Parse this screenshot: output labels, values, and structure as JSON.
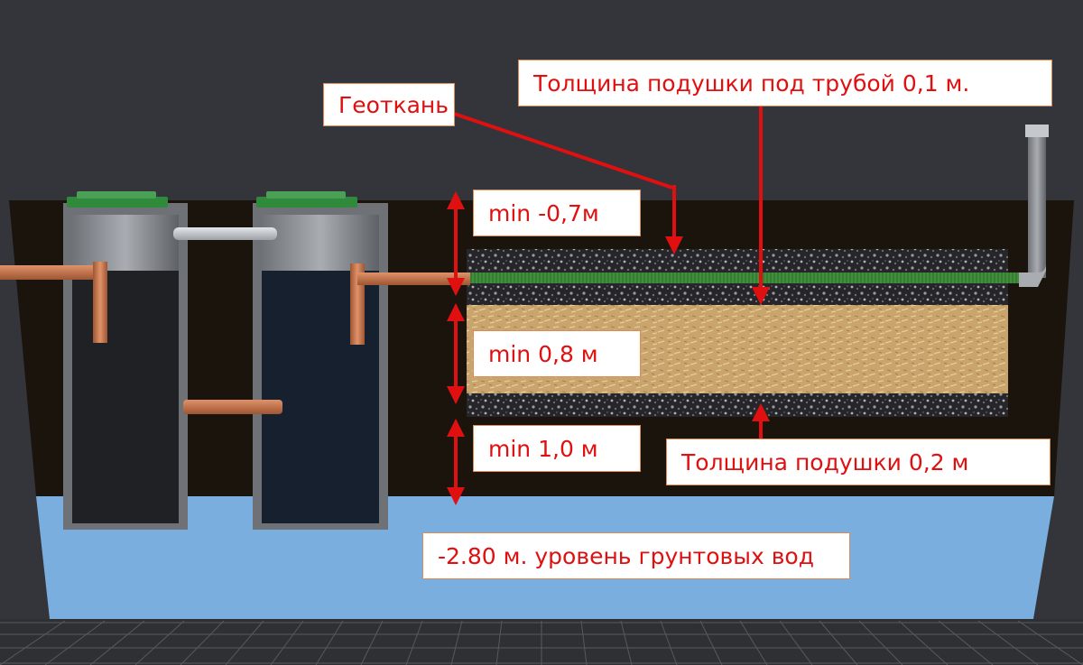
{
  "labels": {
    "geotextile": "Геоткань",
    "pipe_bed": "Толщина подушки под трубой 0,1 м.",
    "min_cover": "min -0,7м",
    "min_sand": "min 0,8 м",
    "min_clearance": "min 1,0 м",
    "bed": "Толщина подушки 0,2 м",
    "groundwater": "-2.80 м. уровень грунтовых вод"
  },
  "colors": {
    "background": "#34353a",
    "soil": "#1b140c",
    "groundwater": "#7aaedf",
    "sand": "#c9a46d",
    "gravel": "#2a2a2c",
    "drain_pipe": "#3f8f3c",
    "sewer_pipe": "#c8754a",
    "label_text": "#e01010",
    "arrow": "#e01010"
  }
}
